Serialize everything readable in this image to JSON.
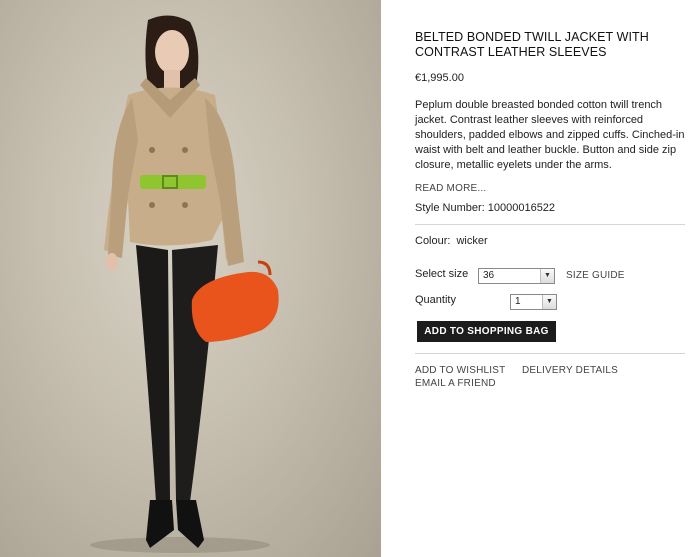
{
  "product": {
    "title": "BELTED BONDED TWILL JACKET WITH CONTRAST LEATHER SLEEVES",
    "price": "€1,995.00",
    "description": "Peplum double breasted bonded cotton twill trench jacket. Contrast leather sleeves with reinforced shoulders, padded elbows and zipped cuffs. Cinched-in waist with belt and leather buckle. Button and side zip closure, metallic eyelets under the arms.",
    "read_more_label": "READ MORE...",
    "style_number": "Style Number: 10000016522",
    "colour_label": "Colour:",
    "colour_value": "wicker"
  },
  "options": {
    "size_label": "Select size",
    "size_value": "36",
    "size_guide_label": "SIZE GUIDE",
    "quantity_label": "Quantity",
    "quantity_value": "1",
    "add_to_bag_label": "ADD TO SHOPPING BAG"
  },
  "links": {
    "wishlist": "ADD TO WISHLIST",
    "delivery": "DELIVERY DETAILS",
    "email": "EMAIL A FRIEND"
  },
  "colors": {
    "button_bg": "#1c1c1c",
    "photo_bg": "#c6bfb0",
    "belt": "#8fc62f",
    "bag": "#e8541c"
  },
  "icons": {
    "select_arrow": "chevron-down-icon"
  }
}
